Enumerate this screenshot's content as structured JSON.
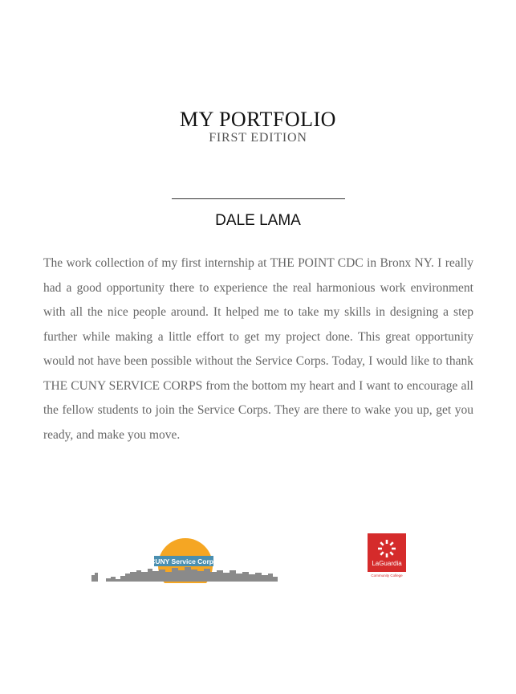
{
  "title": "MY PORTFOLIO",
  "subtitle": "FIRST EDITION",
  "author": "DALE LAMA",
  "body": "The work collection of my first internship at THE POINT CDC in Bronx NY. I really had a good opportunity there to experience the real harmonious work environment with all the nice people around. It helped me to take my skills in designing a step further while making a little effort to get my project done. This great opportunity would not have been possible without the Service Corps. Today, I would like to thank THE CUNY SERVICE CORPS from the bottom my heart and I want to encourage all the fellow students to join the Service Corps. They are there to wake you up, get you ready, and make you move.",
  "logos": {
    "cuny": {
      "icon": "cuny-service-corps-logo",
      "text": "CUNY Service Corps",
      "colors": {
        "sun": "#f5a623",
        "skyline": "#8a8a8a",
        "badge": "#4a8fb0"
      }
    },
    "laguardia": {
      "icon": "laguardia-logo",
      "name": "LaGuardia",
      "subtitle": "Community College",
      "color": "#d52b2b"
    }
  }
}
